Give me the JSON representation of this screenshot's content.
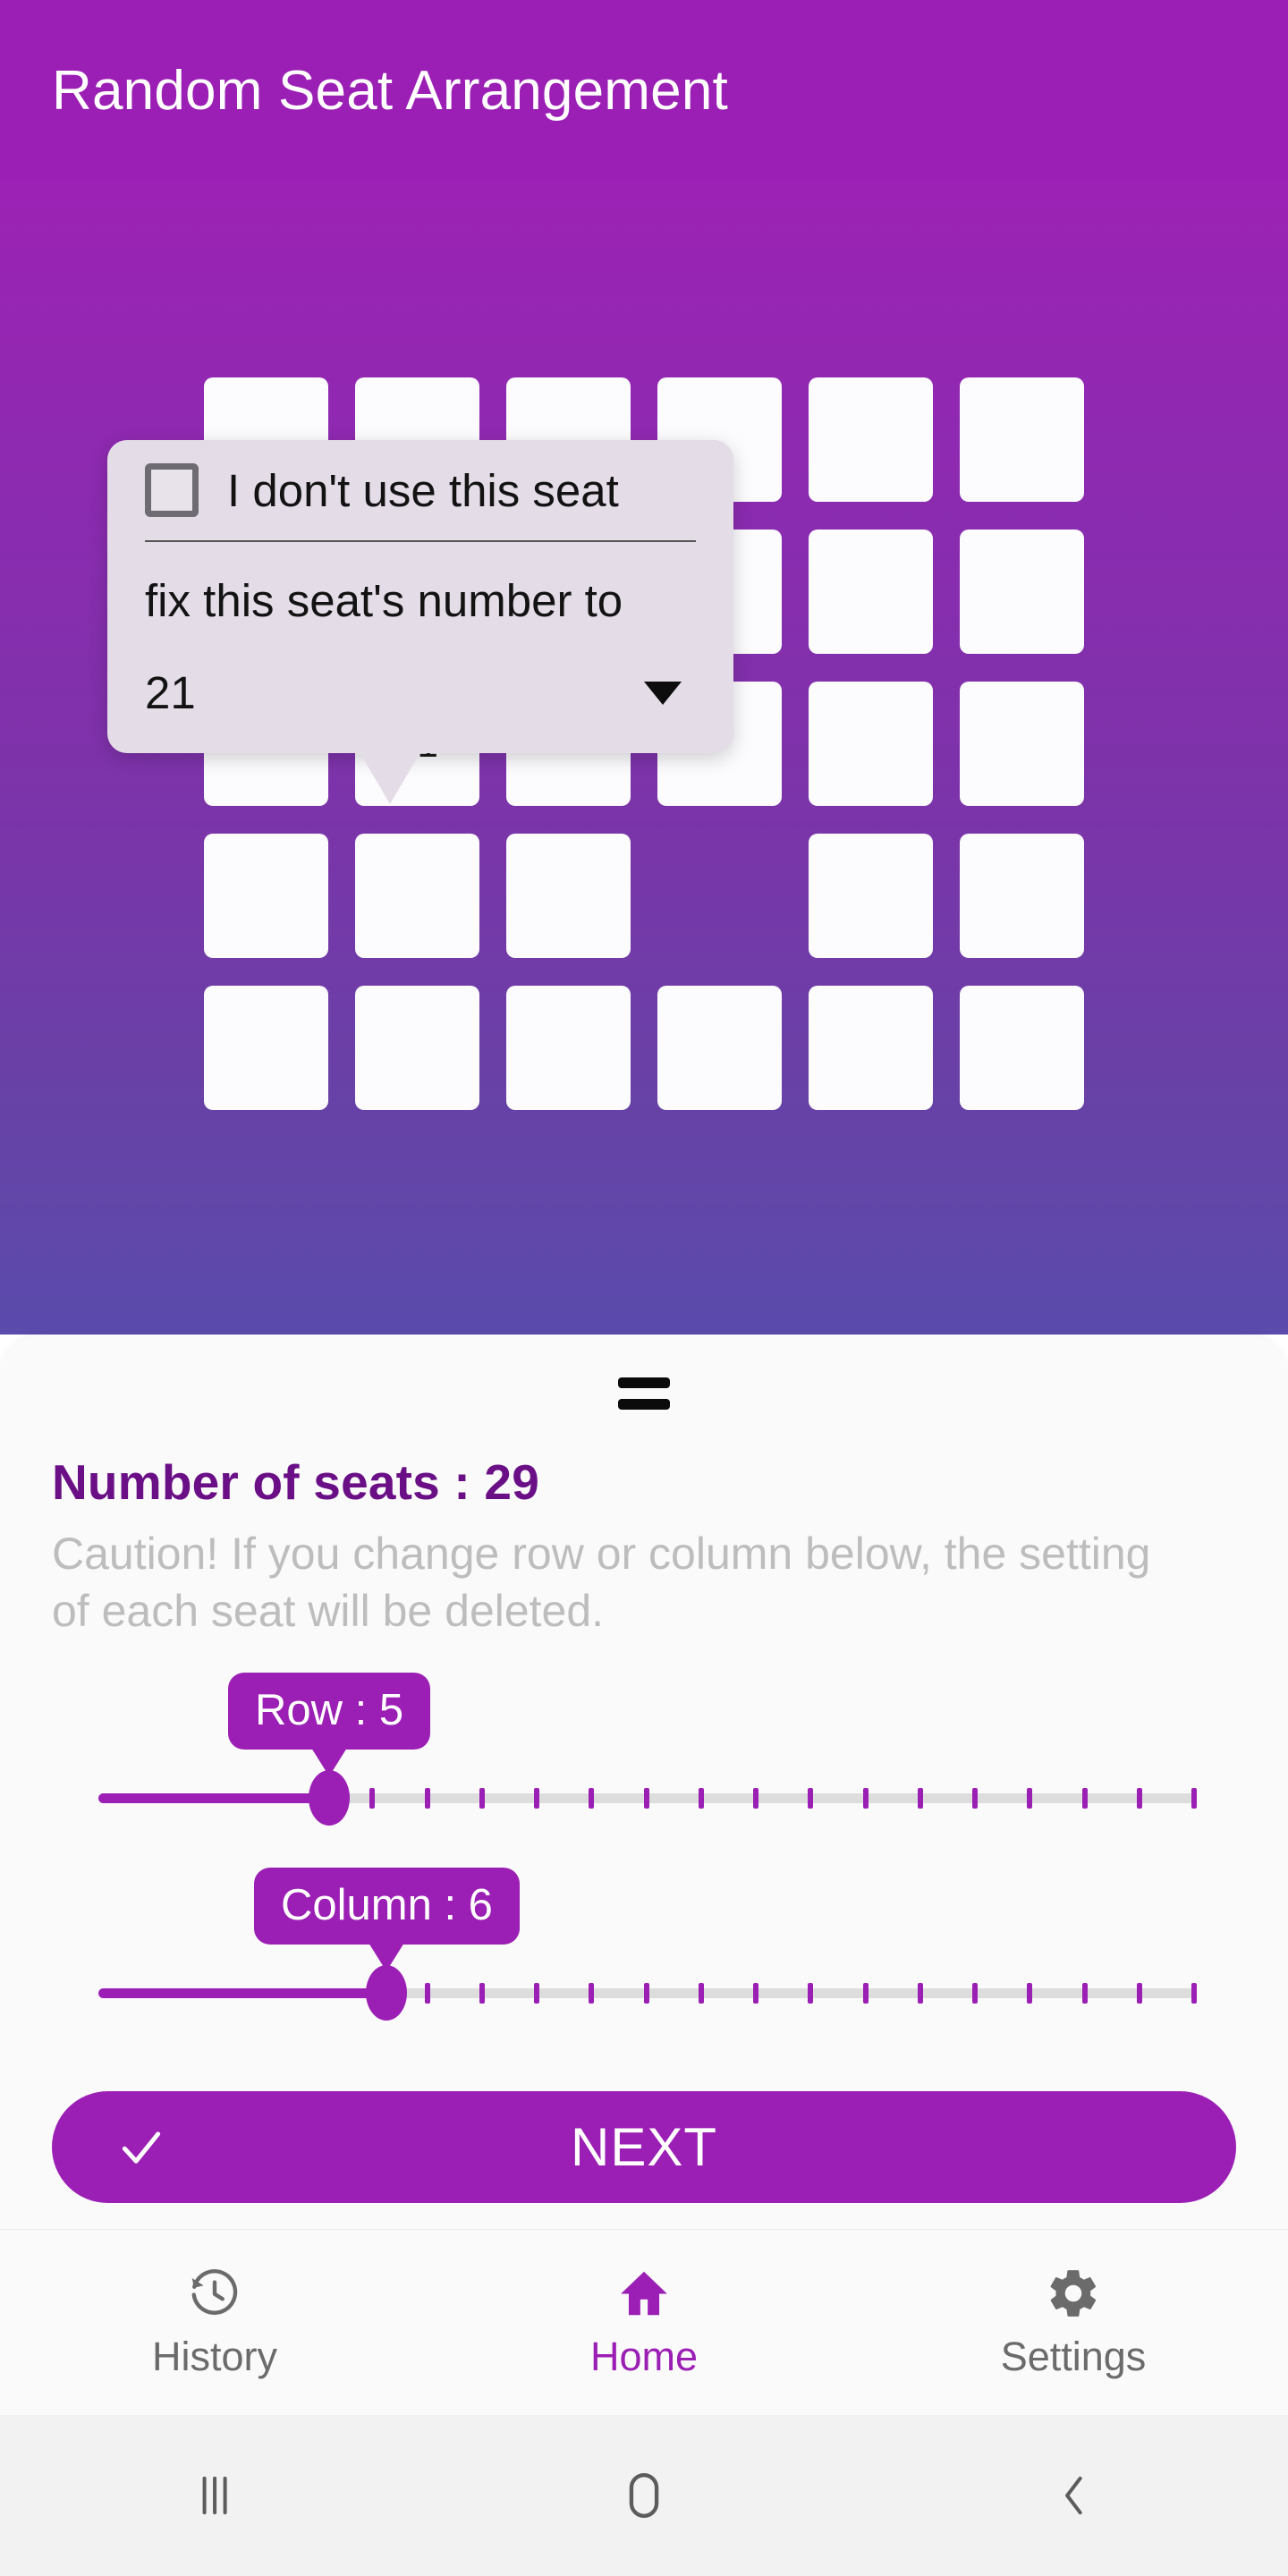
{
  "appbar": {
    "title": "Random Seat Arrangement"
  },
  "seat_popup": {
    "checkbox_label": "I don't use this seat",
    "checkbox_checked": false,
    "fix_label": "fix this seat's number to",
    "selected_number": "21",
    "caret_icon": "chevron-down-icon"
  },
  "grid": {
    "rows": 5,
    "columns": 6,
    "seats": [
      [
        {
          "present": true,
          "label": ""
        },
        {
          "present": true,
          "label": ""
        },
        {
          "present": true,
          "label": ""
        },
        {
          "present": true,
          "label": ""
        },
        {
          "present": true,
          "label": ""
        },
        {
          "present": true,
          "label": ""
        }
      ],
      [
        {
          "present": true,
          "label": ""
        },
        {
          "present": true,
          "label": ""
        },
        {
          "present": true,
          "label": ""
        },
        {
          "present": true,
          "label": ""
        },
        {
          "present": true,
          "label": ""
        },
        {
          "present": true,
          "label": ""
        }
      ],
      [
        {
          "present": true,
          "label": ""
        },
        {
          "present": true,
          "label": "21"
        },
        {
          "present": true,
          "label": ""
        },
        {
          "present": true,
          "label": ""
        },
        {
          "present": true,
          "label": ""
        },
        {
          "present": true,
          "label": ""
        }
      ],
      [
        {
          "present": true,
          "label": ""
        },
        {
          "present": true,
          "label": ""
        },
        {
          "present": true,
          "label": ""
        },
        {
          "present": false,
          "label": ""
        },
        {
          "present": true,
          "label": ""
        },
        {
          "present": true,
          "label": ""
        }
      ],
      [
        {
          "present": true,
          "label": ""
        },
        {
          "present": true,
          "label": ""
        },
        {
          "present": true,
          "label": ""
        },
        {
          "present": true,
          "label": ""
        },
        {
          "present": true,
          "label": ""
        },
        {
          "present": true,
          "label": ""
        }
      ]
    ]
  },
  "sheet": {
    "drag_handle_icon": "drag-handle-icon",
    "seat_count_text": "Number of seats : 29",
    "caution_text": "Caution! If you change row or column below, the setting of each seat will be deleted."
  },
  "sliders": {
    "row": {
      "bubble_label": "Row : 5",
      "value": 5,
      "min": 1,
      "max": 20,
      "ticks": 20
    },
    "column": {
      "bubble_label": "Column : 6",
      "value": 6,
      "min": 1,
      "max": 20,
      "ticks": 20
    }
  },
  "next_button": {
    "label": "NEXT",
    "check_icon": "check-icon"
  },
  "bottom_nav": {
    "items": [
      {
        "label": "History",
        "icon": "history-icon",
        "active": false
      },
      {
        "label": "Home",
        "icon": "home-icon",
        "active": true
      },
      {
        "label": "Settings",
        "icon": "gear-icon",
        "active": false
      }
    ]
  },
  "system_nav": {
    "items": [
      {
        "icon": "recents-icon"
      },
      {
        "icon": "home-circle-icon"
      },
      {
        "icon": "back-icon"
      }
    ]
  },
  "colors": {
    "brand_purple": "#9B1FB4",
    "seat_count_purple": "#6A0F86",
    "gradient_top": "#9C22B5",
    "gradient_bottom": "#5A4BAC",
    "caution_gray": "#BDBDBD",
    "sheet_bg": "#FAFAFA",
    "popup_bg": "#E4DCE7"
  }
}
